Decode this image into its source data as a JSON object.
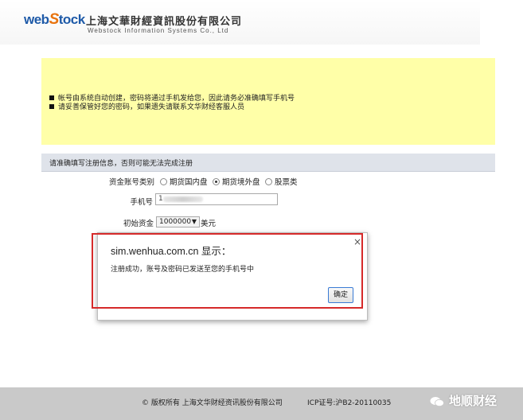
{
  "header": {
    "logo_prefix": "web",
    "logo_o": "S",
    "logo_suffix": "tock",
    "company_cn": "上海文華財經資訊股份有限公司",
    "company_en": "Webstock Information Systems Co., Ltd"
  },
  "notice": {
    "lines": [
      "帐号由系统自动创建，密码将通过手机发给您，因此请务必准确填写手机号",
      "请妥善保管好您的密码，如果遗失请联系文华财经客服人员"
    ]
  },
  "form": {
    "bar_text": "请准确填写注册信息，否则可能无法完成注册",
    "account_type_label": "资金账号类别",
    "account_type_options": [
      {
        "label": "期货国内盘",
        "selected": false
      },
      {
        "label": "期货境外盘",
        "selected": true
      },
      {
        "label": "股票类",
        "selected": false
      }
    ],
    "phone_label": "手机号",
    "phone_value": "1",
    "capital_label": "初始资金",
    "capital_value": "1000000",
    "capital_unit": "美元"
  },
  "dialog": {
    "title": "sim.wenhua.com.cn 显示：",
    "message": "注册成功，账号及密码已发送至您的手机号中",
    "ok_label": "确定",
    "close_symbol": "×"
  },
  "footer": {
    "copyright": "© 版权所有  上海文华财经资讯股份有限公司",
    "icp": "ICP证号:沪B2-20110035",
    "watermark": "地顺财经"
  },
  "colors": {
    "notice_bg": "#ffffa8",
    "form_bar_bg": "#dfe3ea",
    "highlight_border": "#d62a2a",
    "footer_bg": "#c9c9c9"
  }
}
